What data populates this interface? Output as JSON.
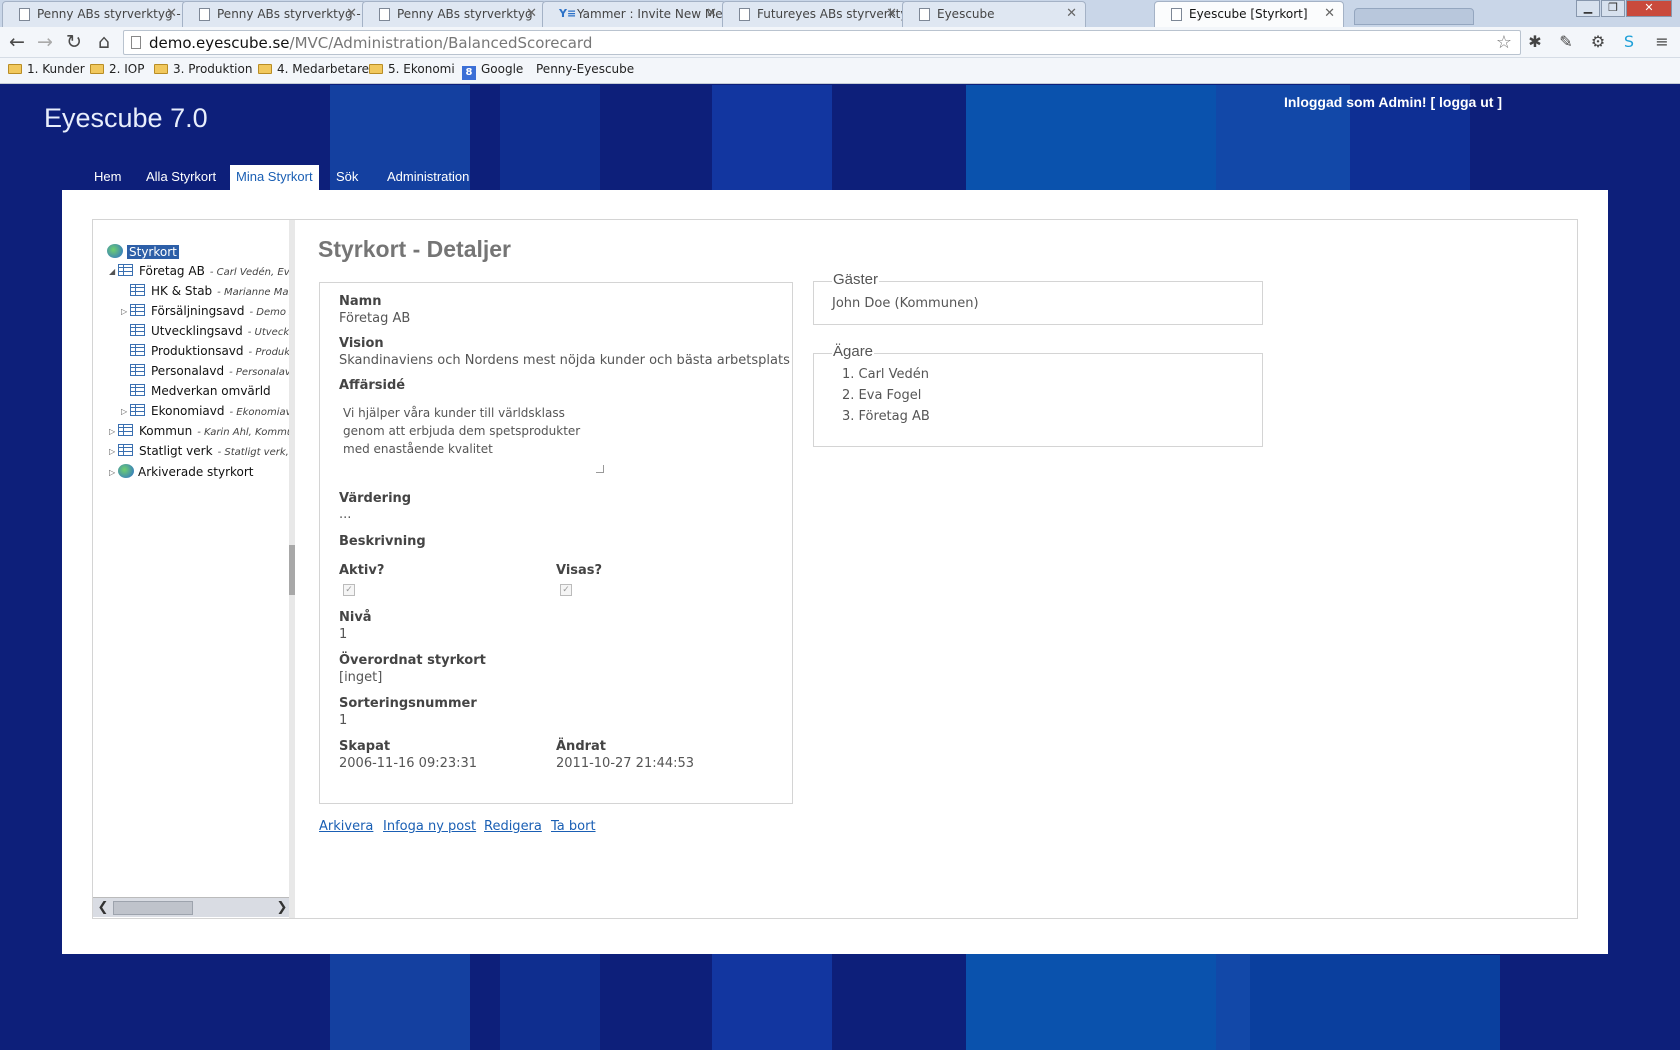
{
  "browser": {
    "tabs": [
      {
        "title": "Penny ABs styrverktyg - Sta",
        "active": false
      },
      {
        "title": "Penny ABs styrverktyg - Ak",
        "active": false
      },
      {
        "title": "Penny ABs styrverktyg",
        "active": false
      },
      {
        "title": "Yammer : Invite New Mem",
        "active": false
      },
      {
        "title": "Futureyes ABs styrverktyg -",
        "active": false
      },
      {
        "title": "Eyescube",
        "active": false
      },
      {
        "title": "Eyescube [Styrkort]",
        "active": true
      }
    ],
    "url_host": "demo.eyescube.se",
    "url_path": "/MVC/Administration/BalancedScorecard",
    "bookmarks": [
      "1. Kunder",
      "2. IOP",
      "3. Produktion",
      "4. Medarbetare",
      "5. Ekonomi",
      "Google",
      "Penny-Eyescube"
    ]
  },
  "app": {
    "title": "Eyescube 7.0",
    "login_text": "Inloggad som Admin! [ logga ut ]"
  },
  "nav": [
    "Hem",
    "Alla Styrkort",
    "Mina Styrkort",
    "Sök",
    "Administration"
  ],
  "tree": {
    "root": "Styrkort",
    "items": [
      {
        "label": "Företag AB",
        "sub": "- Carl Vedén, Eva ."
      },
      {
        "label": "HK & Stab",
        "sub": "- Marianne Manf"
      },
      {
        "label": "Försäljningsavd",
        "sub": "- Demo An"
      },
      {
        "label": "Utvecklingsavd",
        "sub": "- Utvecklin"
      },
      {
        "label": "Produktionsavd",
        "sub": "- Produktic"
      },
      {
        "label": "Personalavd",
        "sub": "- Personalavd"
      },
      {
        "label": "Medverkan omvärld",
        "sub": ""
      },
      {
        "label": "Ekonomiavd",
        "sub": "- Ekonomiavd"
      },
      {
        "label": "Kommun",
        "sub": "- Karin Ahl, Kommun"
      },
      {
        "label": "Statligt verk",
        "sub": "- Statligt verk, B"
      },
      {
        "label": "Arkiverade styrkort",
        "sub": ""
      }
    ]
  },
  "details": {
    "heading": "Styrkort - Detaljer",
    "namn_label": "Namn",
    "namn": "Företag AB",
    "vision_label": "Vision",
    "vision": "Skandinaviens och Nordens mest nöjda kunder och bästa arbetsplats",
    "affarside_label": "Affärsidé",
    "affarside_lines": [
      "Vi hjälper våra kunder till världsklass",
      "genom att erbjuda dem spetsprodukter",
      "med enastående kvalitet"
    ],
    "vardering_label": "Värdering",
    "vardering": "...",
    "beskrivning_label": "Beskrivning",
    "aktiv_label": "Aktiv?",
    "visas_label": "Visas?",
    "niva_label": "Nivå",
    "niva": "1",
    "overordnat_label": "Överordnat styrkort",
    "overordnat": "[inget]",
    "sortering_label": "Sorteringsnummer",
    "sortering": "1",
    "skapat_label": "Skapat",
    "skapat": "2006-11-16 09:23:31",
    "andrat_label": "Ändrat",
    "andrat": "2011-10-27 21:44:53"
  },
  "guests": {
    "legend": "Gäster",
    "value": "John Doe (Kommunen)"
  },
  "owners": {
    "legend": "Ägare",
    "items": [
      "1. Carl Vedén",
      "2. Eva Fogel",
      "3. Företag AB"
    ]
  },
  "actions": [
    "Arkivera",
    "Infoga ny post",
    "Redigera",
    "Ta bort"
  ]
}
